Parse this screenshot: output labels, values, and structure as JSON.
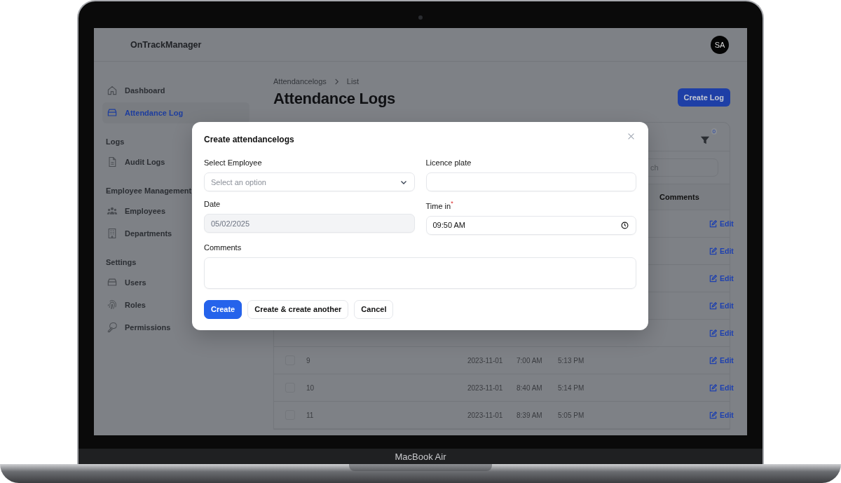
{
  "device": {
    "label": "MacBook Air"
  },
  "app": {
    "brand": "OnTrackManager",
    "avatar": "SA"
  },
  "sidebar": {
    "groups": [
      {
        "items": [
          {
            "label": "Dashboard",
            "selected": false
          },
          {
            "label": "Attendance Log",
            "selected": true
          }
        ]
      },
      {
        "heading": "Logs",
        "items": [
          {
            "label": "Audit Logs",
            "selected": false
          }
        ]
      },
      {
        "heading": "Employee Management",
        "items": [
          {
            "label": "Employees",
            "selected": false
          },
          {
            "label": "Departments",
            "selected": false
          }
        ]
      },
      {
        "heading": "Settings",
        "items": [
          {
            "label": "Users",
            "selected": false
          },
          {
            "label": "Roles",
            "selected": false
          },
          {
            "label": "Permissions",
            "selected": false
          }
        ]
      }
    ]
  },
  "breadcrumbs": [
    "Attendancelogs",
    "List"
  ],
  "page_title": "Attendance Logs",
  "create_button": "Create Log",
  "table": {
    "filter_count": "0",
    "search_placeholder": "ch",
    "column_header": "Comments",
    "rows": [
      {
        "edit": "Edit"
      },
      {
        "edit": "Edit"
      },
      {
        "edit": "Edit"
      },
      {
        "edit": "Edit"
      },
      {
        "edit": "Edit"
      },
      {
        "checked": false,
        "id": "9",
        "date": "2023-11-01",
        "time_in": "7:00 AM",
        "time_out": "5:13 PM",
        "edit": "Edit"
      },
      {
        "checked": false,
        "id": "10",
        "date": "2023-11-01",
        "time_in": "8:40 AM",
        "time_out": "5:14 PM",
        "edit": "Edit"
      },
      {
        "checked": false,
        "id": "11",
        "date": "2023-11-01",
        "time_in": "8:39 AM",
        "time_out": "5:05 PM",
        "edit": "Edit"
      }
    ]
  },
  "modal": {
    "title": "Create attendancelogs",
    "fields": [
      {
        "kind": "select",
        "label": "Select Employee",
        "placeholder": "Select an option"
      },
      {
        "kind": "text",
        "label": "Licence plate"
      },
      {
        "kind": "text",
        "label": "Date",
        "value": "05/02/2025",
        "disabled": true
      },
      {
        "kind": "time",
        "label": "Time in",
        "required_mark": "*",
        "value": "09:50 AM"
      },
      {
        "kind": "textarea",
        "label": "Comments"
      }
    ],
    "buttons": [
      {
        "label": "Create",
        "primary": true
      },
      {
        "label": "Create & create another",
        "primary": false
      },
      {
        "label": "Cancel",
        "primary": false
      }
    ]
  }
}
